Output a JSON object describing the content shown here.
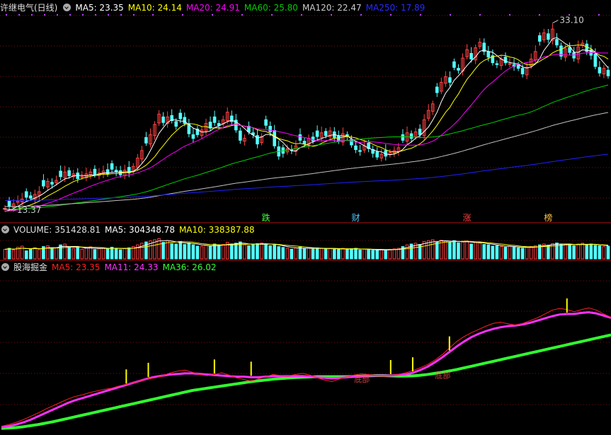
{
  "colors": {
    "background": "#000000",
    "up": "#ff4040",
    "down": "#54fcfc",
    "grid": "#7a1010",
    "ma5": "#ffffff",
    "ma10": "#ffff00",
    "ma20": "#ff00ff",
    "ma60": "#00d000",
    "ma120": "#c0c0c0",
    "ma250": "#2020ff",
    "ind_ma5": "#ff2020",
    "ind_ma11": "#ff30ff",
    "ind_ma36": "#30ff30",
    "signal": "#ffff00"
  },
  "main_panel": {
    "title": "许继电气(日线)",
    "menu_icon": "chevron-down-circle-icon",
    "ma5": "MA5: 23.35",
    "ma10": "MA10: 24.14",
    "ma20": "MA20: 24.91",
    "ma60": "MA60: 25.80",
    "ma120": "MA120: 22.47",
    "ma250": "MA250: 17.89",
    "high_label": "33.10",
    "low_label": "13.37",
    "event_labels": [
      {
        "text": "跌",
        "color": "#40ff40",
        "idx": 61
      },
      {
        "text": "财",
        "color": "#54c8fc",
        "idx": 82
      },
      {
        "text": "涨",
        "color": "#ff4040",
        "idx": 108
      },
      {
        "text": "榜",
        "color": "#ffc040",
        "idx": 127
      }
    ]
  },
  "volume_panel": {
    "title": "VOLUME: 351428.81",
    "ma5": "MA5: 304348.78",
    "ma10": "MA10: 338387.88"
  },
  "indicator_panel": {
    "title": "股海掘金",
    "ma5": "MA5: 23.35",
    "ma11": "MA11: 24.33",
    "ma36": "MA36: 26.02",
    "marker_text": "底部"
  },
  "chart_data": [
    {
      "type": "candlestick",
      "title": "许继电气(日线)",
      "closes": [
        13.4,
        13.6,
        13.9,
        14.2,
        14.4,
        14.6,
        14.5,
        14.9,
        15.2,
        15.8,
        16.3,
        16.0,
        16.4,
        16.8,
        17.3,
        16.9,
        17.1,
        16.6,
        16.8,
        17.1,
        17.3,
        17.0,
        17.2,
        17.4,
        17.1,
        17.6,
        17.3,
        17.0,
        17.5,
        17.2,
        17.9,
        18.8,
        19.6,
        20.4,
        21.3,
        22.4,
        23.5,
        22.6,
        23.2,
        22.8,
        22.2,
        23.0,
        22.5,
        21.4,
        20.9,
        21.3,
        21.8,
        22.5,
        22.0,
        22.6,
        22.3,
        22.9,
        23.7,
        22.7,
        21.8,
        20.7,
        20.9,
        21.6,
        21.3,
        20.3,
        21.1,
        22.3,
        21.6,
        20.1,
        19.0,
        19.3,
        19.8,
        19.6,
        20.1,
        20.7,
        20.3,
        20.9,
        20.6,
        21.1,
        21.5,
        21.2,
        21.7,
        21.0,
        20.6,
        21.4,
        21.1,
        20.2,
        19.7,
        19.5,
        20.1,
        19.8,
        19.3,
        18.9,
        19.2,
        19.0,
        19.4,
        19.6,
        19.9,
        20.7,
        21.5,
        20.9,
        21.6,
        21.3,
        22.9,
        23.9,
        24.6,
        25.8,
        26.9,
        27.5,
        26.9,
        28.5,
        28.2,
        29.5,
        30.4,
        29.4,
        30.6,
        31.2,
        30.2,
        29.6,
        29.0,
        28.8,
        29.4,
        29.0,
        28.9,
        28.6,
        28.4,
        27.8,
        28.5,
        29.4,
        30.2,
        31.3,
        32.2,
        31.5,
        32.6,
        30.9,
        29.7,
        30.5,
        30.1,
        29.5,
        30.7,
        31.1,
        30.2,
        29.8,
        28.6,
        27.9,
        28.4,
        27.6
      ],
      "ylim": [
        13.0,
        34.2
      ],
      "high": 33.1,
      "low": 13.37,
      "moving_averages": [
        "MA5",
        "MA10",
        "MA20",
        "MA60",
        "MA120",
        "MA250"
      ]
    },
    {
      "type": "bar",
      "title": "VOLUME",
      "values": [
        0.45,
        0.5,
        0.42,
        0.55,
        0.6,
        0.38,
        0.47,
        0.52,
        0.44,
        0.58,
        0.62,
        0.48,
        0.51,
        0.66,
        0.7,
        0.55,
        0.49,
        0.53,
        0.46,
        0.5,
        0.57,
        0.44,
        0.48,
        0.52,
        0.47,
        0.55,
        0.5,
        0.43,
        0.49,
        0.52,
        0.58,
        0.66,
        0.74,
        0.8,
        0.85,
        0.9,
        0.95,
        0.78,
        0.86,
        0.72,
        0.7,
        0.82,
        0.68,
        0.75,
        0.66,
        0.6,
        0.58,
        0.64,
        0.6,
        0.7,
        0.63,
        0.68,
        0.78,
        0.7,
        0.74,
        0.8,
        0.66,
        0.62,
        0.68,
        0.72,
        0.75,
        0.7,
        0.62,
        0.66,
        0.58,
        0.54,
        0.5,
        0.46,
        0.52,
        0.55,
        0.48,
        0.5,
        0.46,
        0.52,
        0.5,
        0.47,
        0.49,
        0.45,
        0.44,
        0.5,
        0.46,
        0.48,
        0.5,
        0.42,
        0.46,
        0.44,
        0.41,
        0.4,
        0.44,
        0.42,
        0.45,
        0.47,
        0.5,
        0.58,
        0.66,
        0.7,
        0.74,
        0.68,
        0.82,
        0.86,
        0.9,
        0.8,
        0.88,
        0.84,
        0.78,
        0.86,
        0.76,
        0.8,
        0.84,
        0.7,
        0.78,
        0.74,
        0.68,
        0.66,
        0.6,
        0.62,
        0.58,
        0.55,
        0.6,
        0.56,
        0.52,
        0.5,
        0.54,
        0.58,
        0.62,
        0.66,
        0.7,
        0.64,
        0.72,
        0.75,
        0.7,
        0.68,
        0.66,
        0.62,
        0.7,
        0.74,
        0.66,
        0.7,
        0.64,
        0.62,
        0.58,
        0.6
      ],
      "ylim": [
        0,
        1
      ]
    },
    {
      "type": "line",
      "title": "股海掘金",
      "series": [
        {
          "name": "MA5",
          "values": [
            13.2,
            13.5,
            13.9,
            14.4,
            15.0,
            15.6,
            16.3,
            16.9,
            17.5,
            18.1,
            18.6,
            18.9,
            19.3,
            19.6,
            19.9,
            20.1,
            20.5,
            20.8,
            21.1,
            21.5,
            21.8,
            22.0,
            22.4,
            22.9,
            23.2,
            23.4,
            23.0,
            22.6,
            22.4,
            22.6,
            22.9,
            22.5,
            22.0,
            21.7,
            21.4,
            21.8,
            22.2,
            22.6,
            22.4,
            22.3,
            22.6,
            22.8,
            22.5,
            22.0,
            21.6,
            21.3,
            21.8,
            22.2,
            22.5,
            22.7,
            22.6,
            22.4,
            22.3,
            22.4,
            22.6,
            22.9,
            23.3,
            23.8,
            24.4,
            25.2,
            26.2,
            27.4,
            28.6,
            29.5,
            30.2,
            30.8,
            31.4,
            31.9,
            32.1,
            31.8,
            31.6,
            31.9,
            32.4,
            32.9,
            33.6,
            34.3,
            34.6,
            34.4,
            34.0,
            34.4,
            34.7,
            34.3,
            33.6,
            33.0
          ]
        },
        {
          "name": "MA11",
          "values": [
            13.0,
            13.2,
            13.5,
            13.9,
            14.4,
            15.0,
            15.6,
            16.2,
            16.8,
            17.4,
            17.9,
            18.3,
            18.7,
            19.1,
            19.5,
            19.9,
            20.3,
            20.7,
            21.1,
            21.5,
            21.9,
            22.2,
            22.4,
            22.6,
            22.7,
            22.8,
            22.8,
            22.7,
            22.6,
            22.5,
            22.4,
            22.3,
            22.2,
            22.2,
            22.1,
            22.1,
            22.2,
            22.3,
            22.3,
            22.3,
            22.3,
            22.3,
            22.2,
            22.1,
            22.0,
            21.9,
            22.0,
            22.1,
            22.2,
            22.3,
            22.4,
            22.4,
            22.4,
            22.4,
            22.5,
            22.6,
            22.9,
            23.4,
            24.0,
            24.8,
            25.7,
            26.7,
            27.7,
            28.6,
            29.4,
            30.0,
            30.5,
            30.9,
            31.2,
            31.4,
            31.5,
            31.7,
            32.0,
            32.4,
            32.8,
            33.2,
            33.5,
            33.6,
            33.6,
            33.8,
            33.9,
            33.7,
            33.3,
            32.9
          ]
        },
        {
          "name": "MA36",
          "values": [
            12.8,
            12.85,
            12.95,
            13.1,
            13.3,
            13.5,
            13.75,
            14.0,
            14.3,
            14.6,
            14.9,
            15.2,
            15.5,
            15.8,
            16.1,
            16.4,
            16.7,
            17.0,
            17.3,
            17.6,
            17.9,
            18.2,
            18.5,
            18.8,
            19.1,
            19.4,
            19.7,
            19.9,
            20.1,
            20.3,
            20.5,
            20.7,
            20.9,
            21.1,
            21.3,
            21.45,
            21.6,
            21.75,
            21.85,
            21.95,
            22.05,
            22.1,
            22.15,
            22.2,
            22.2,
            22.2,
            22.2,
            22.2,
            22.25,
            22.3,
            22.35,
            22.4,
            22.4,
            22.35,
            22.3,
            22.3,
            22.35,
            22.45,
            22.6,
            22.8,
            23.0,
            23.25,
            23.5,
            23.8,
            24.1,
            24.4,
            24.7,
            25.0,
            25.3,
            25.6,
            25.9,
            26.2,
            26.5,
            26.8,
            27.1,
            27.4,
            27.7,
            28.0,
            28.3,
            28.6,
            28.9,
            29.2,
            29.5,
            29.8
          ]
        }
      ],
      "signals": [
        17,
        20,
        29,
        34,
        53,
        56,
        61,
        77
      ]
    }
  ]
}
